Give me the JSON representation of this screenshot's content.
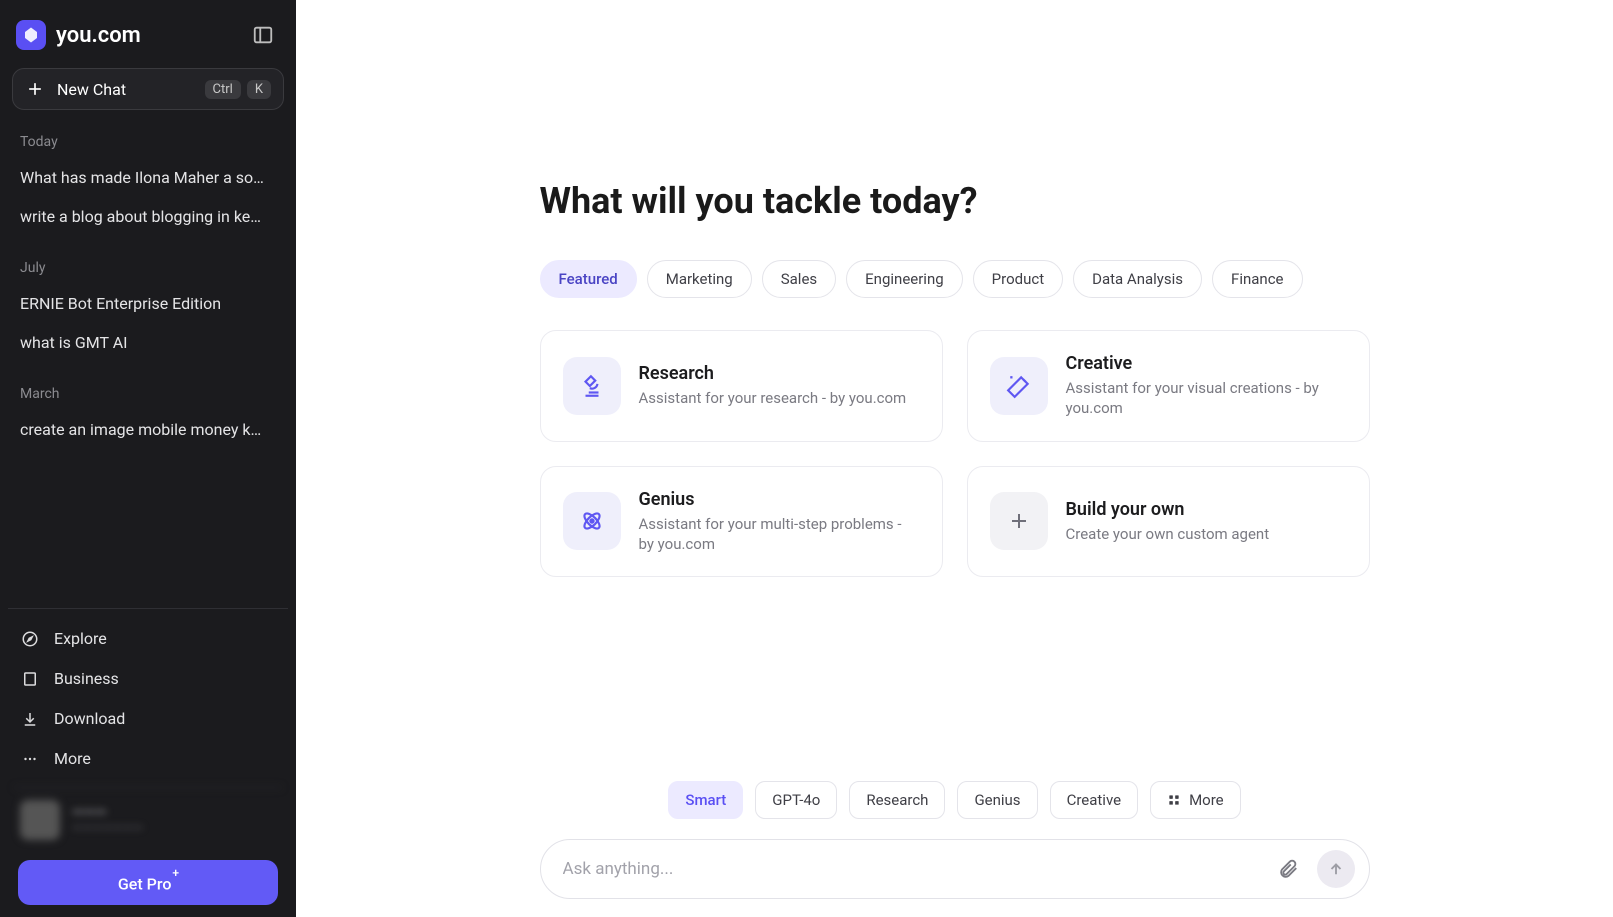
{
  "brand": {
    "name": "you.com"
  },
  "new_chat": {
    "label": "New Chat",
    "kbd1": "Ctrl",
    "kbd2": "K"
  },
  "history": {
    "groups": [
      {
        "label": "Today",
        "items": [
          "What has made Ilona Maher a so…",
          "write a blog about blogging in ke…"
        ]
      },
      {
        "label": "July",
        "items": [
          "ERNIE Bot Enterprise Edition",
          "what is GMT AI"
        ]
      },
      {
        "label": "March",
        "items": [
          "create an image mobile money k…"
        ]
      }
    ]
  },
  "nav": {
    "explore": "Explore",
    "business": "Business",
    "download": "Download",
    "more": "More"
  },
  "account": {
    "name": "———",
    "email": "———————"
  },
  "get_pro": {
    "label": "Get Pro"
  },
  "hero_title": "What will you tackle today?",
  "categories": [
    "Featured",
    "Marketing",
    "Sales",
    "Engineering",
    "Product",
    "Data Analysis",
    "Finance"
  ],
  "cards": {
    "research": {
      "title": "Research",
      "desc": "Assistant for your research - by you.com"
    },
    "creative": {
      "title": "Creative",
      "desc": "Assistant for your visual creations - by you.com"
    },
    "genius": {
      "title": "Genius",
      "desc": "Assistant for your multi-step problems - by you.com"
    },
    "build": {
      "title": "Build your own",
      "desc": "Create your own custom agent"
    }
  },
  "models": [
    "Smart",
    "GPT-4o",
    "Research",
    "Genius",
    "Creative",
    "More"
  ],
  "prompt": {
    "placeholder": "Ask anything..."
  }
}
